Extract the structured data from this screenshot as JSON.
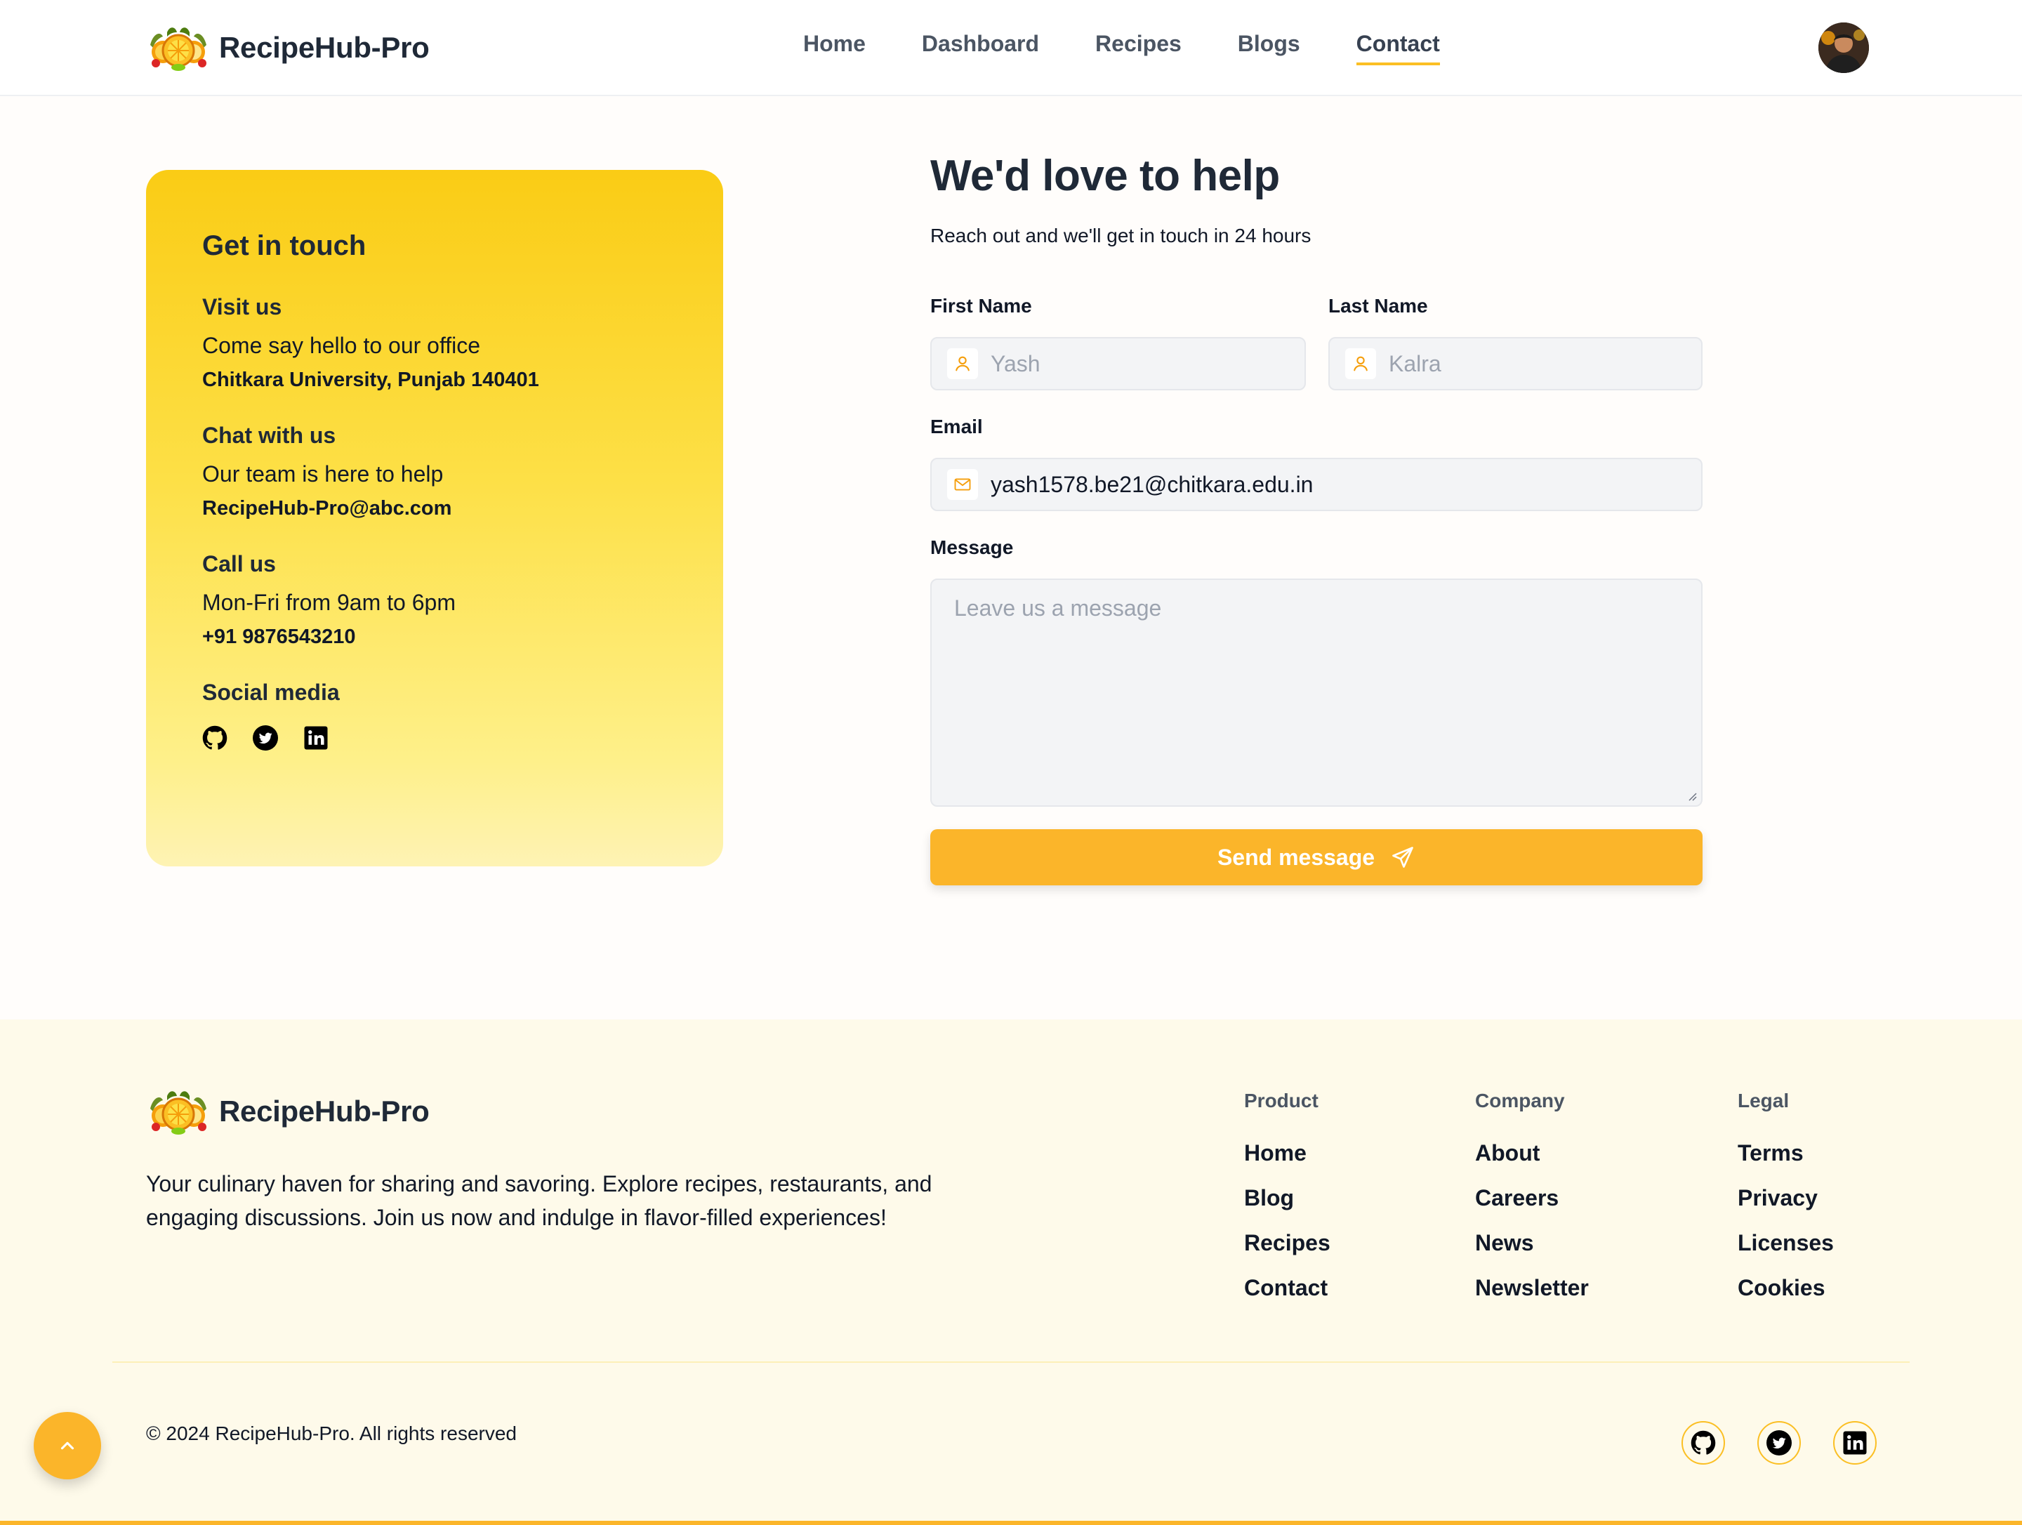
{
  "brand": {
    "name": "RecipeHub-Pro"
  },
  "nav": {
    "items": [
      {
        "label": "Home"
      },
      {
        "label": "Dashboard"
      },
      {
        "label": "Recipes"
      },
      {
        "label": "Blogs"
      },
      {
        "label": "Contact"
      }
    ],
    "active": "Contact"
  },
  "info": {
    "title": "Get in touch",
    "visit": {
      "heading": "Visit us",
      "text": "Come say hello to our office",
      "detail": "Chitkara University, Punjab 140401"
    },
    "chat": {
      "heading": "Chat with us",
      "text": "Our team is here to help",
      "detail": "RecipeHub-Pro@abc.com"
    },
    "call": {
      "heading": "Call us",
      "text": "Mon-Fri from 9am to 6pm",
      "detail": "+91 9876543210"
    },
    "social": {
      "heading": "Social media",
      "icons": [
        "github-icon",
        "twitter-icon",
        "linkedin-icon"
      ]
    }
  },
  "form": {
    "title": "We'd love to help",
    "subtitle": "Reach out and we'll get in touch in 24 hours",
    "first_name": {
      "label": "First Name",
      "placeholder": "Yash",
      "icon": "user-icon"
    },
    "last_name": {
      "label": "Last Name",
      "placeholder": "Kalra",
      "icon": "user-icon"
    },
    "email": {
      "label": "Email",
      "value": "yash1578.be21@chitkara.edu.in",
      "icon": "mail-icon"
    },
    "message": {
      "label": "Message",
      "placeholder": "Leave us a message"
    },
    "submit": {
      "label": "Send message",
      "icon": "send-icon"
    }
  },
  "footer": {
    "description": "Your culinary haven for sharing and savoring. Explore recipes, restaurants, and engaging discussions. Join us now and indulge in flavor-filled experiences!",
    "columns": [
      {
        "heading": "Product",
        "links": [
          "Home",
          "Blog",
          "Recipes",
          "Contact"
        ]
      },
      {
        "heading": "Company",
        "links": [
          "About",
          "Careers",
          "News",
          "Newsletter"
        ]
      },
      {
        "heading": "Legal",
        "links": [
          "Terms",
          "Privacy",
          "Licenses",
          "Cookies"
        ]
      }
    ],
    "copyright": "© 2024 RecipeHub-Pro. All rights reserved"
  },
  "colors": {
    "accent": "#fbb52a",
    "card_top": "#facc15",
    "card_bottom": "#fef3b4",
    "footer_bg": "#fefaea"
  }
}
